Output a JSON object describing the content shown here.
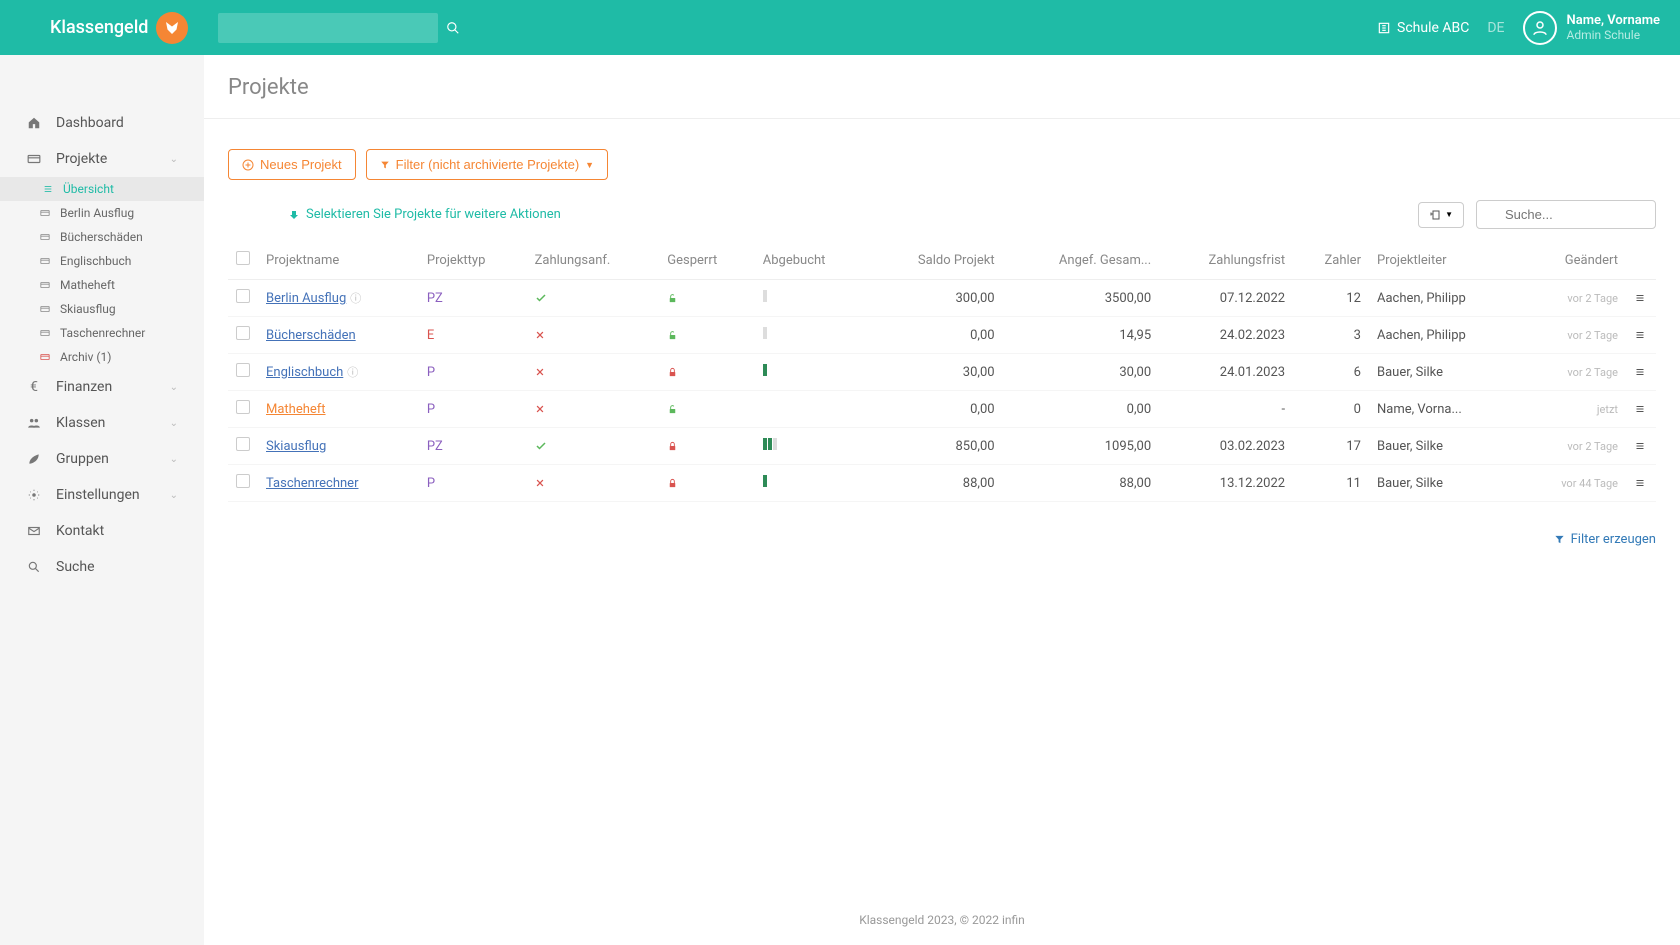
{
  "brand_name": "Klassengeld",
  "top_search_placeholder": "",
  "school": "Schule ABC",
  "lang": "DE",
  "user_name": "Name, Vorname",
  "user_role": "Admin Schule",
  "sidebar": {
    "dashboard": "Dashboard",
    "projekte": "Projekte",
    "submenu": [
      {
        "label": "Übersicht"
      },
      {
        "label": "Berlin Ausflug"
      },
      {
        "label": "Bücherschäden"
      },
      {
        "label": "Englischbuch"
      },
      {
        "label": "Matheheft"
      },
      {
        "label": "Skiausflug"
      },
      {
        "label": "Taschenrechner"
      },
      {
        "label": "Archiv (1)"
      }
    ],
    "finanzen": "Finanzen",
    "klassen": "Klassen",
    "gruppen": "Gruppen",
    "einstellungen": "Einstellungen",
    "kontakt": "Kontakt",
    "suche": "Suche"
  },
  "page_title": "Projekte",
  "btn_new": "Neues Projekt",
  "btn_filter": "Filter (nicht archivierte Projekte)",
  "select_hint": "Selektieren Sie Projekte für weitere Aktionen",
  "table_search_placeholder": "Suche...",
  "columns": {
    "name": "Projektname",
    "type": "Projekttyp",
    "zahlungsanf": "Zahlungsanf.",
    "gesperrt": "Gesperrt",
    "abgebucht": "Abgebucht",
    "saldo": "Saldo Projekt",
    "angef": "Angef. Gesam...",
    "frist": "Zahlungsfrist",
    "zahler": "Zahler",
    "leiter": "Projektleiter",
    "geaendert": "Geändert"
  },
  "rows": [
    {
      "name": "Berlin Ausflug",
      "info": true,
      "type": "PZ",
      "za": true,
      "locked": false,
      "prog_fill": 0,
      "prog_total": 1,
      "saldo": "300,00",
      "angef": "3500,00",
      "frist": "07.12.2022",
      "zahler": "12",
      "leiter": "Aachen, Philipp",
      "geaendert": "vor 2 Tage"
    },
    {
      "name": "Bücherschäden",
      "type": "E",
      "za": false,
      "locked": false,
      "prog_fill": 0,
      "prog_total": 1,
      "saldo": "0,00",
      "angef": "14,95",
      "frist": "24.02.2023",
      "zahler": "3",
      "leiter": "Aachen, Philipp",
      "geaendert": "vor 2 Tage"
    },
    {
      "name": "Englischbuch",
      "info": true,
      "type": "P",
      "za": false,
      "locked": true,
      "prog_fill": 1,
      "prog_total": 1,
      "saldo": "30,00",
      "angef": "30,00",
      "frist": "24.01.2023",
      "zahler": "6",
      "leiter": "Bauer, Silke",
      "geaendert": "vor 2 Tage"
    },
    {
      "name": "Matheheft",
      "highlight": true,
      "type": "P",
      "za": false,
      "locked": false,
      "prog_fill": 0,
      "prog_total": 0,
      "saldo": "0,00",
      "angef": "0,00",
      "frist": "-",
      "zahler": "0",
      "leiter": "Name, Vorna...",
      "geaendert": "jetzt"
    },
    {
      "name": "Skiausflug",
      "type": "PZ",
      "za": true,
      "locked": true,
      "prog_fill": 2,
      "prog_total": 3,
      "saldo": "850,00",
      "angef": "1095,00",
      "frist": "03.02.2023",
      "zahler": "17",
      "leiter": "Bauer, Silke",
      "geaendert": "vor 2 Tage"
    },
    {
      "name": "Taschenrechner",
      "type": "P",
      "za": false,
      "locked": true,
      "prog_fill": 1,
      "prog_total": 1,
      "saldo": "88,00",
      "angef": "88,00",
      "frist": "13.12.2022",
      "zahler": "11",
      "leiter": "Bauer, Silke",
      "geaendert": "vor 44 Tage"
    }
  ],
  "filter_create": "Filter erzeugen",
  "footer": "Klassengeld 2023, © 2022 infin"
}
